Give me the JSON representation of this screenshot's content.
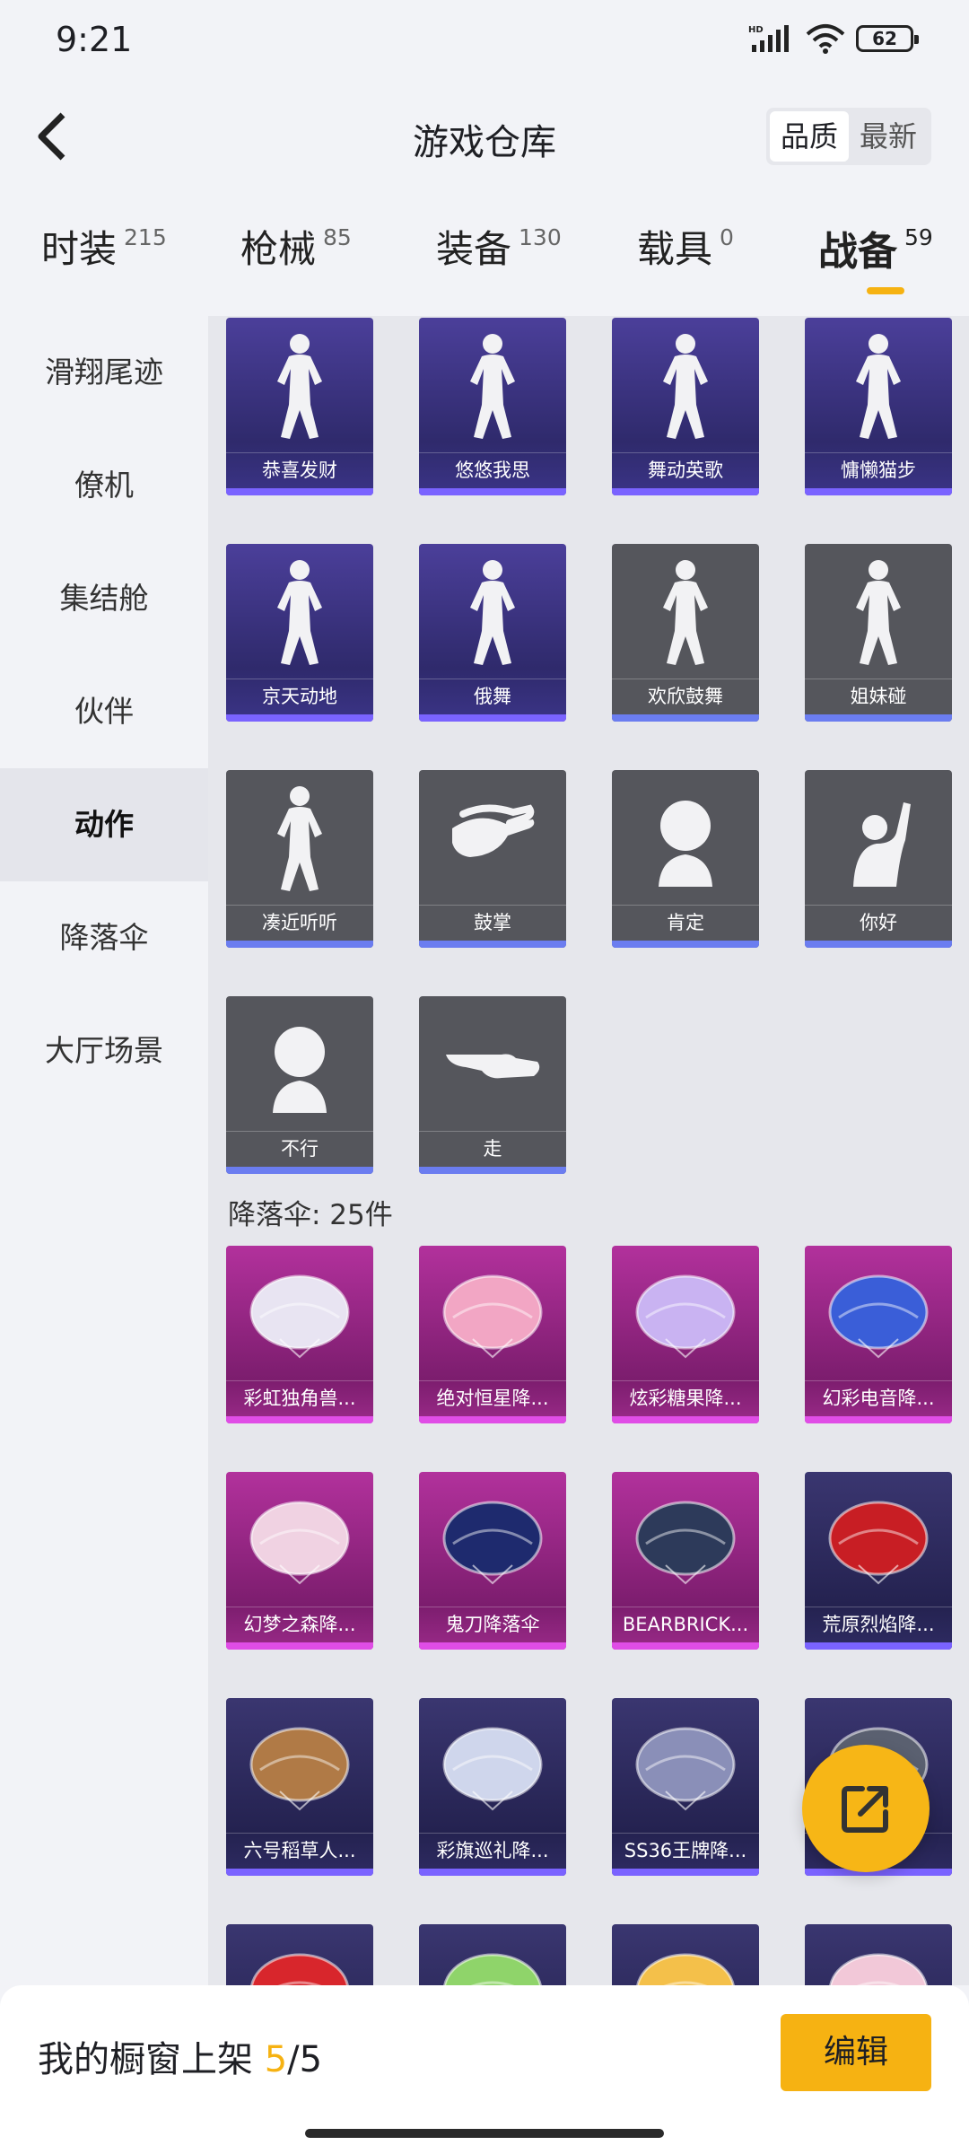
{
  "status": {
    "time": "9:21",
    "battery": "62",
    "signal": "HD"
  },
  "header": {
    "title": "游戏仓库",
    "sort": [
      "品质",
      "最新"
    ],
    "sort_active": 0
  },
  "tabs": [
    {
      "label": "时装",
      "count": "215"
    },
    {
      "label": "枪械",
      "count": "85"
    },
    {
      "label": "装备",
      "count": "130"
    },
    {
      "label": "载具",
      "count": "0"
    },
    {
      "label": "战备",
      "count": "59"
    }
  ],
  "active_tab": 4,
  "sidebar": [
    "滑翔尾迹",
    "僚机",
    "集结舱",
    "伙伴",
    "动作",
    "降落伞",
    "大厅场景"
  ],
  "active_sidebar": 4,
  "actions": [
    {
      "name": "恭喜发财",
      "quality": "purple",
      "icon": "gesture-icon"
    },
    {
      "name": "悠悠我思",
      "quality": "purple",
      "icon": "gesture-icon"
    },
    {
      "name": "舞动英歌",
      "quality": "purple",
      "icon": "gesture-icon"
    },
    {
      "name": "慵懒猫步",
      "quality": "purple",
      "icon": "gesture-icon"
    },
    {
      "name": "京天动地",
      "quality": "purple",
      "icon": "gesture-icon"
    },
    {
      "name": "俄舞",
      "quality": "purple",
      "icon": "gesture-icon"
    },
    {
      "name": "欢欣鼓舞",
      "quality": "grey",
      "icon": "gesture-icon"
    },
    {
      "name": "姐妹碰",
      "quality": "grey",
      "icon": "gesture-icon"
    },
    {
      "name": "凑近听听",
      "quality": "grey",
      "icon": "gesture-icon"
    },
    {
      "name": "鼓掌",
      "quality": "grey",
      "icon": "clap-icon"
    },
    {
      "name": "肯定",
      "quality": "grey",
      "icon": "head-icon"
    },
    {
      "name": "你好",
      "quality": "grey",
      "icon": "wave-icon"
    },
    {
      "name": "不行",
      "quality": "grey",
      "icon": "head-icon"
    },
    {
      "name": "走",
      "quality": "grey",
      "icon": "point-icon"
    }
  ],
  "parachute_section": {
    "title": "降落伞: 25件"
  },
  "parachutes": [
    {
      "name": "彩虹独角兽...",
      "quality": "pink",
      "color": "#e8e4f2"
    },
    {
      "name": "绝对恒星降...",
      "quality": "pink",
      "color": "#f2a6c4"
    },
    {
      "name": "炫彩糖果降...",
      "quality": "pink",
      "color": "#c9b3f2"
    },
    {
      "name": "幻彩电音降...",
      "quality": "pink",
      "color": "#3a5ed8"
    },
    {
      "name": "幻梦之森降...",
      "quality": "pink",
      "color": "#f0d2e2"
    },
    {
      "name": "鬼刀降落伞",
      "quality": "pink",
      "color": "#1e2a6e"
    },
    {
      "name": "BEARBRICK...",
      "quality": "pink",
      "color": "#2d3a5a"
    },
    {
      "name": "荒原烈焰降...",
      "quality": "navy",
      "color": "#c81e24"
    },
    {
      "name": "六号稻草人...",
      "quality": "navy",
      "color": "#b07a46"
    },
    {
      "name": "彩旗巡礼降...",
      "quality": "navy",
      "color": "#cfd6ec"
    },
    {
      "name": "SS36王牌降...",
      "quality": "navy",
      "color": "#8a8fb8"
    },
    {
      "name": "",
      "quality": "navy",
      "color": "#5a6070"
    },
    {
      "name": "",
      "quality": "navy",
      "color": "#d8262c"
    },
    {
      "name": "",
      "quality": "navy",
      "color": "#8fd46a"
    },
    {
      "name": "",
      "quality": "navy",
      "color": "#f4c04a"
    },
    {
      "name": "",
      "quality": "navy",
      "color": "#f2c8d8"
    }
  ],
  "bottom": {
    "label": "我的橱窗上架 ",
    "current": "5",
    "total": "/5",
    "edit": "编辑"
  },
  "colors": {
    "accent": "#f6b212",
    "purple_bar": "#7a63ff",
    "pink_card": "#a52a92"
  }
}
